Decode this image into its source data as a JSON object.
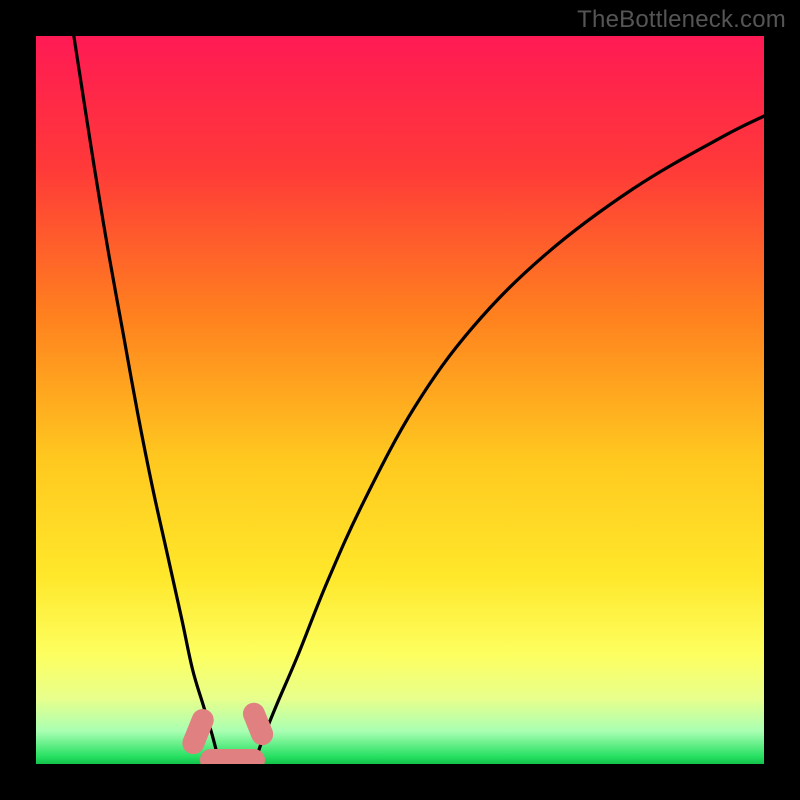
{
  "watermark": "TheBottleneck.com",
  "colors": {
    "gradient_stops": [
      {
        "pos": 0.0,
        "color": "#ff1a54"
      },
      {
        "pos": 0.18,
        "color": "#ff3939"
      },
      {
        "pos": 0.38,
        "color": "#ff7f1f"
      },
      {
        "pos": 0.58,
        "color": "#ffc81f"
      },
      {
        "pos": 0.74,
        "color": "#ffe72a"
      },
      {
        "pos": 0.85,
        "color": "#fdff60"
      },
      {
        "pos": 0.91,
        "color": "#e8ff8c"
      },
      {
        "pos": 0.955,
        "color": "#a9ffb3"
      },
      {
        "pos": 0.99,
        "color": "#26e061"
      },
      {
        "pos": 1.0,
        "color": "#12c24a"
      }
    ],
    "curve": "#000000",
    "pill": "#e08080",
    "frame": "#000000",
    "watermark_text": "#555555"
  },
  "chart_data": {
    "type": "line",
    "title": "",
    "xlabel": "",
    "ylabel": "",
    "xlim": [
      0,
      100
    ],
    "ylim": [
      0,
      100
    ],
    "series": [
      {
        "name": "left-branch",
        "x": [
          5.2,
          8,
          10,
          12,
          14,
          16,
          18,
          20,
          21.5,
          23,
          24.2,
          25,
          25.5
        ],
        "y": [
          100,
          82,
          70,
          59,
          48,
          38,
          29,
          20,
          13,
          8,
          4,
          1,
          0
        ]
      },
      {
        "name": "right-branch",
        "x": [
          30,
          31,
          33,
          36,
          40,
          45,
          52,
          60,
          70,
          82,
          94,
          100
        ],
        "y": [
          0,
          3,
          8,
          15,
          25,
          36,
          49,
          60,
          70,
          79,
          86,
          89
        ]
      }
    ],
    "markers": [
      {
        "name": "left-pill",
        "cx": 22.2,
        "cy": 4.5,
        "w": 3.0,
        "h": 6.5,
        "angle_deg": 22
      },
      {
        "name": "right-pill",
        "cx": 30.5,
        "cy": 5.5,
        "w": 3.0,
        "h": 6.0,
        "angle_deg": -22
      },
      {
        "name": "base-pill",
        "cx": 27.0,
        "cy": 0.5,
        "w": 9.0,
        "h": 3.0,
        "angle_deg": 0
      }
    ]
  }
}
